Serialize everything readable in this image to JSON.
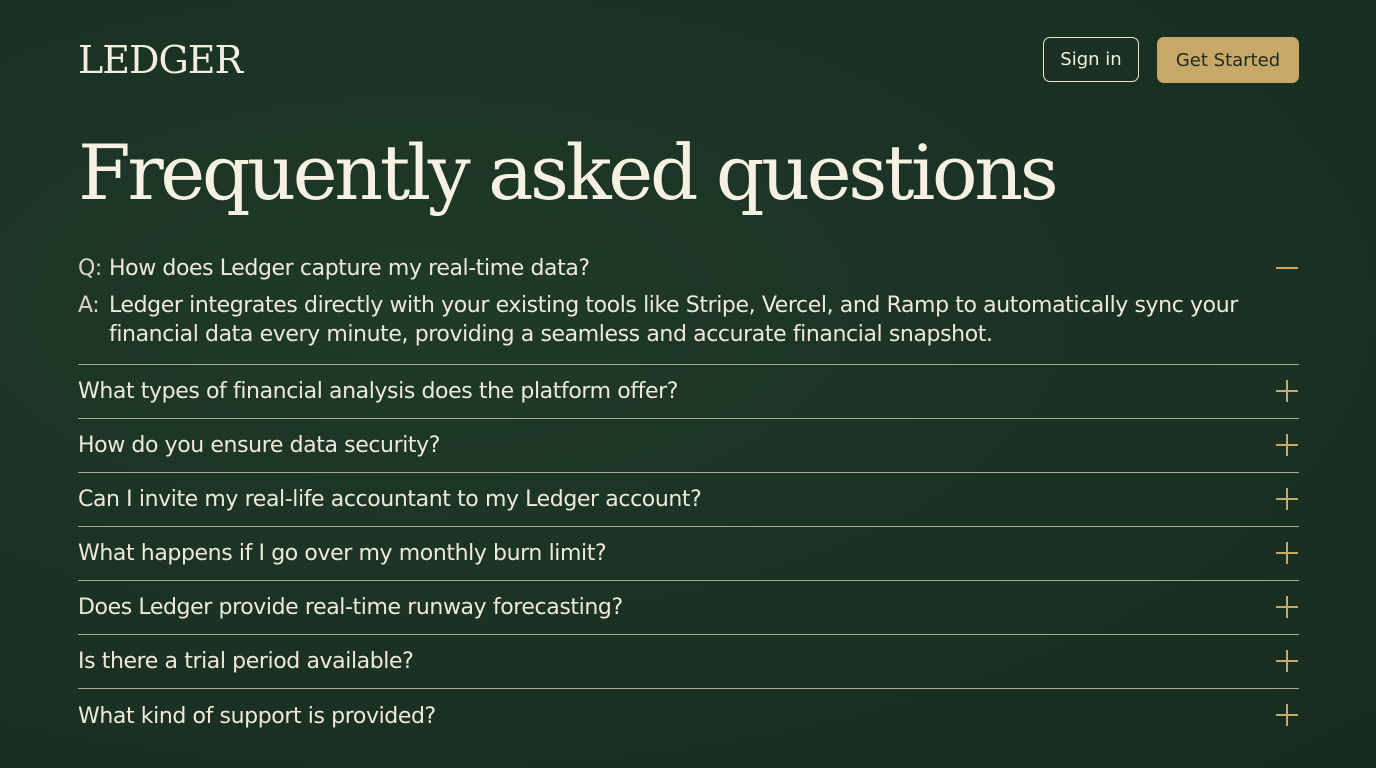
{
  "header": {
    "logo": "LEDGER",
    "sign_in_label": "Sign in",
    "get_started_label": "Get Started"
  },
  "page_title": "Frequently asked questions",
  "faq": {
    "open_item": {
      "question_prefix": "Q:",
      "question": "How does Ledger capture my real-time data?",
      "answer_prefix": "A:",
      "answer": "Ledger integrates directly with your existing tools like Stripe, Vercel, and Ramp to automatically sync your financial data every minute, providing a seamless and accurate financial snapshot.",
      "toggle_icon": "minus-icon"
    },
    "items": [
      {
        "question": "What types of financial analysis does the platform offer?",
        "toggle_icon": "plus-icon"
      },
      {
        "question": "How do you ensure data security?",
        "toggle_icon": "plus-icon"
      },
      {
        "question": "Can I invite my real-life accountant to my Ledger account?",
        "toggle_icon": "plus-icon"
      },
      {
        "question": "What happens if I go over my monthly burn limit?",
        "toggle_icon": "plus-icon"
      },
      {
        "question": "Does Ledger provide real-time runway forecasting?",
        "toggle_icon": "plus-icon"
      },
      {
        "question": "Is there a trial period available?",
        "toggle_icon": "plus-icon"
      },
      {
        "question": "What kind of support is provided?",
        "toggle_icon": "plus-icon"
      }
    ]
  },
  "colors": {
    "background": "#1a3223",
    "accent_gold": "#c7a866",
    "text_cream": "#f3eedf",
    "divider": "#a5ab96"
  }
}
